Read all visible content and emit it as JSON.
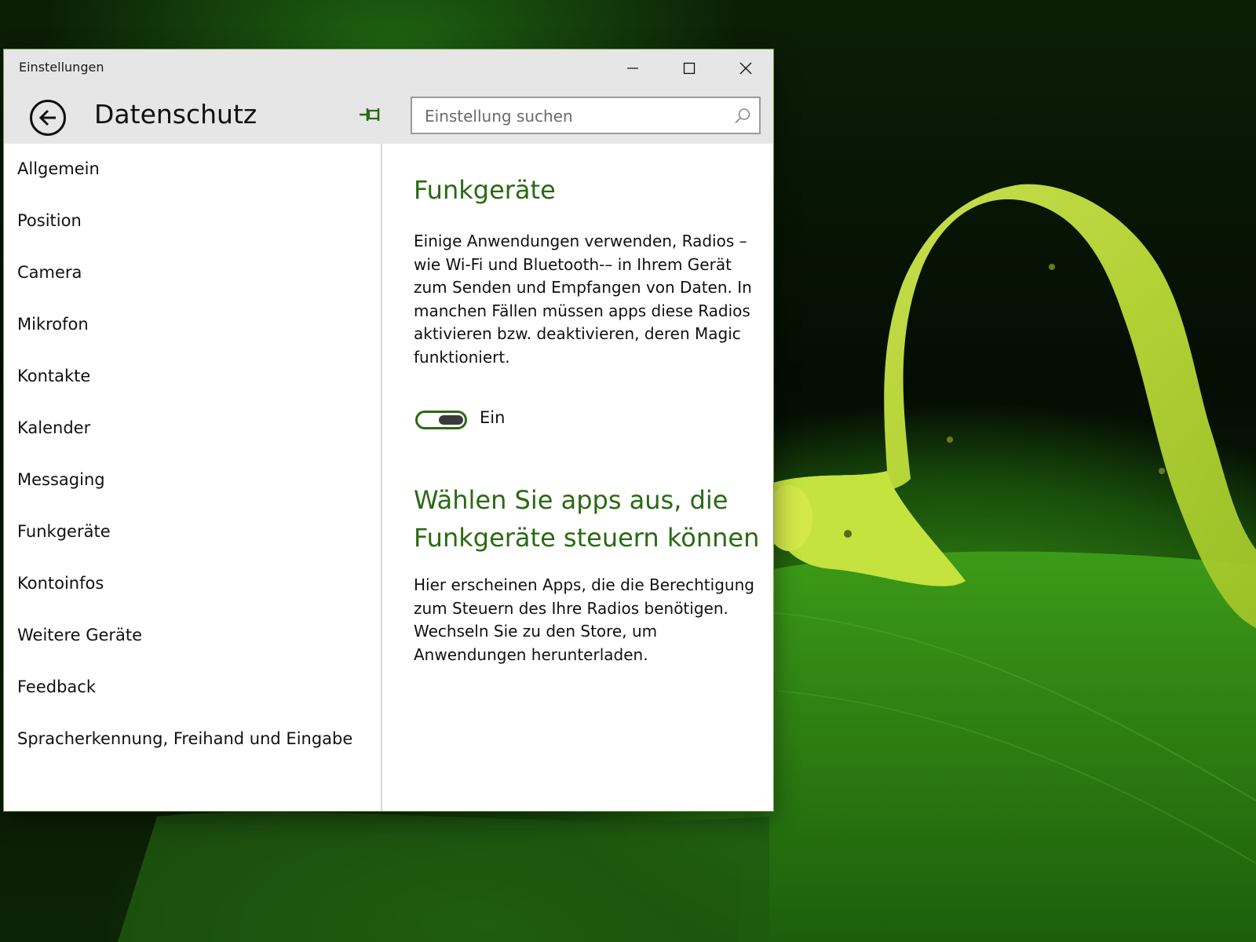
{
  "window": {
    "title": "Einstellungen",
    "page_title": "Datenschutz"
  },
  "search": {
    "placeholder": "Einstellung suchen"
  },
  "sidebar": {
    "items": [
      {
        "label": "Allgemein"
      },
      {
        "label": "Position"
      },
      {
        "label": "Camera"
      },
      {
        "label": "Mikrofon"
      },
      {
        "label": "Kontakte"
      },
      {
        "label": "Kalender"
      },
      {
        "label": "Messaging"
      },
      {
        "label": "Funkgeräte"
      },
      {
        "label": "Kontoinfos"
      },
      {
        "label": "Weitere Geräte"
      },
      {
        "label": "Feedback"
      },
      {
        "label": "Spracherkennung, Freihand und Eingabe"
      }
    ]
  },
  "main": {
    "radios_heading": "Funkgeräte",
    "radios_description": "Einige Anwendungen verwenden, Radios – wie Wi-Fi und Bluetooth-– in Ihrem Gerät zum Senden und Empfangen von Daten. In manchen Fällen müssen apps diese Radios aktivieren bzw. deaktivieren, deren Magic funktioniert.",
    "toggle": {
      "state": "on",
      "label": "Ein"
    },
    "apps_heading": "Wählen Sie apps aus, die Funkgeräte steuern können",
    "apps_description": "Hier erscheinen Apps, die die Berechtigung zum Steuern des Ihre Radios benötigen. Wechseln Sie zu den Store, um Anwendungen herunterladen."
  },
  "icons": {
    "back": "back-arrow-icon",
    "pin": "pin-icon",
    "search": "search-icon",
    "minimize": "minimize-icon",
    "maximize": "maximize-icon",
    "close": "close-icon"
  },
  "colors": {
    "accent": "#2a6a12",
    "titlebar": "#e6e6e6",
    "window_bg": "#ffffff"
  }
}
